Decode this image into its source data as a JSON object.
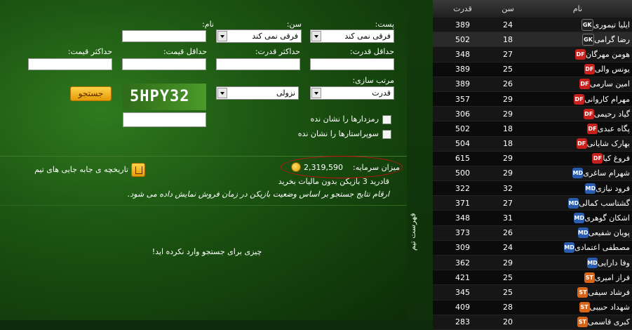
{
  "filters": {
    "post_label": "پست:",
    "age_label": "سن:",
    "name_label": "نام:",
    "post_value": "فرقی نمی کند",
    "age_value": "فرقی نمی کند",
    "min_power_label": "حداقل قدرت:",
    "max_power_label": "حداکثر قدرت:",
    "min_price_label": "حداقل قیمت:",
    "max_price_label": "حداکثر قیمت:",
    "sort_label": "مرتب سازی:",
    "sort_field_value": "قدرت",
    "sort_order_value": "نزولی",
    "captcha_text": "5HPY32",
    "search_button": "جستجو",
    "hide_secret_label": "رمزدارها را نشان نده",
    "hide_superstars_label": "سوپراستارها را نشان نده"
  },
  "budget": {
    "label": "میزان سرمایه:",
    "value": "2,319,590",
    "can_buy_text": "قادرید 3 بازیکن بدون مالیات بخرید",
    "note_text": "ارقام نتایج جستجو بر اساس وضعیت بازیکن در زمان فروش نمایش داده می شود.",
    "history_link": "تاریخچه ی جابه جایی های تیم"
  },
  "results": {
    "empty_message": "چیزی برای جستجو وارد نکرده اید!"
  },
  "sidetab": {
    "label": "فهرست تیم"
  },
  "roster": {
    "columns": {
      "power": "قدرت",
      "age": "سن",
      "name": "نام"
    },
    "position_colors": {
      "GK": "#222222",
      "DF": "#c8201c",
      "MD": "#2a5db0",
      "ST": "#d8641a"
    },
    "players": [
      {
        "pos": "GK",
        "name": "ایلیا تیموری",
        "age": "24",
        "power": "389"
      },
      {
        "pos": "GK",
        "name": "رضا گرامی",
        "age": "18",
        "power": "502"
      },
      {
        "pos": "DF",
        "name": "هومن مهرگان",
        "age": "27",
        "power": "348"
      },
      {
        "pos": "DF",
        "name": "یونس والی",
        "age": "25",
        "power": "389"
      },
      {
        "pos": "DF",
        "name": "امین سارمی",
        "age": "26",
        "power": "389"
      },
      {
        "pos": "DF",
        "name": "مهرام کاروانی",
        "age": "29",
        "power": "357"
      },
      {
        "pos": "DF",
        "name": "گیاد رحیمی",
        "age": "29",
        "power": "306"
      },
      {
        "pos": "DF",
        "name": "پگاه عبدی",
        "age": "18",
        "power": "502"
      },
      {
        "pos": "DF",
        "name": "بهارک شایانی",
        "age": "18",
        "power": "504"
      },
      {
        "pos": "DF",
        "name": "فروغ کیا",
        "age": "29",
        "power": "615"
      },
      {
        "pos": "MD",
        "name": "شهرام ساغری",
        "age": "29",
        "power": "500"
      },
      {
        "pos": "MD",
        "name": "فرود نیازی",
        "age": "32",
        "power": "322"
      },
      {
        "pos": "MD",
        "name": "گشتاسب کمالی",
        "age": "27",
        "power": "371"
      },
      {
        "pos": "MD",
        "name": "اشکان گوهری",
        "age": "31",
        "power": "348"
      },
      {
        "pos": "MD",
        "name": "پویان شفیعی",
        "age": "26",
        "power": "373"
      },
      {
        "pos": "MD",
        "name": "مصطفی اعتمادی",
        "age": "24",
        "power": "309"
      },
      {
        "pos": "MD",
        "name": "وفا دارایی",
        "age": "29",
        "power": "362"
      },
      {
        "pos": "ST",
        "name": "فراز امیری",
        "age": "25",
        "power": "421"
      },
      {
        "pos": "ST",
        "name": "فرشاد سیفی",
        "age": "25",
        "power": "345"
      },
      {
        "pos": "ST",
        "name": "شهداد حبیبی",
        "age": "28",
        "power": "409"
      },
      {
        "pos": "ST",
        "name": "کبری قاسمی",
        "age": "20",
        "power": "283"
      }
    ]
  }
}
